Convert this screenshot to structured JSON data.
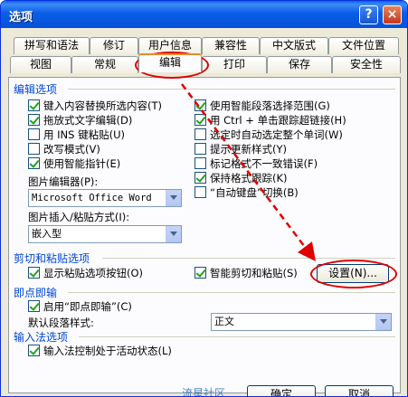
{
  "window": {
    "title": "选项",
    "help_label": "?",
    "close_label": "×"
  },
  "tabs_row1": [
    "拼写和语法",
    "修订",
    "用户信息",
    "兼容性",
    "中文版式",
    "文件位置"
  ],
  "tabs_row2": [
    "视图",
    "常规",
    "编辑",
    "打印",
    "保存",
    "安全性"
  ],
  "active_tab": "编辑",
  "edit_section": {
    "title": "编辑选项",
    "left_options": [
      {
        "label": "键入内容替换所选内容(T)",
        "checked": true
      },
      {
        "label": "拖放式文字编辑(D)",
        "checked": true
      },
      {
        "label": "用 INS 键粘贴(U)",
        "checked": false
      },
      {
        "label": "改写模式(V)",
        "checked": false
      },
      {
        "label": "使用智能指针(E)",
        "checked": true
      }
    ],
    "right_options": [
      {
        "label": "使用智能段落选择范围(G)",
        "checked": true
      },
      {
        "label": "用 Ctrl + 单击跟踪超链接(H)",
        "checked": true
      },
      {
        "label": "选定时自动选定整个单词(W)",
        "checked": false
      },
      {
        "label": "提示更新样式(Y)",
        "checked": false
      },
      {
        "label": "标记格式不一致错误(F)",
        "checked": false
      },
      {
        "label": "保持格式跟踪(K)",
        "checked": true
      },
      {
        "label": "“自动键盘”切换(B)",
        "checked": false
      }
    ],
    "picture_editor_label": "图片编辑器(P):",
    "picture_editor_value": "Microsoft Office Word",
    "insert_label": "图片插入/粘贴方式(I):",
    "insert_value": "嵌入型"
  },
  "cut_section": {
    "title": "剪切和粘贴选项",
    "show_paste_buttons": {
      "label": "显示粘贴选项按钮(O)",
      "checked": true
    },
    "smart_cut": {
      "label": "智能剪切和粘贴(S)",
      "checked": true
    },
    "settings_button": "设置(N)..."
  },
  "click_section": {
    "title": "即点即输",
    "enable": {
      "label": "启用“即点即输”(C)",
      "checked": true
    },
    "default_style_label": "默认段落样式:",
    "default_style_value": "正文"
  },
  "ime_section": {
    "title": "输入法选项",
    "ime_control": {
      "label": "输入法控制处于活动状态(L)",
      "checked": true
    }
  },
  "footer": {
    "watermark": "流星社区",
    "ok_label": "确定",
    "cancel_label": "取消"
  }
}
